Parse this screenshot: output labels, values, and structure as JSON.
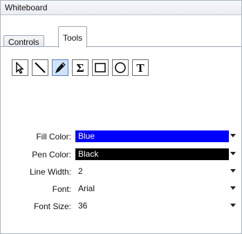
{
  "window": {
    "title": "Whiteboard"
  },
  "tabs": [
    {
      "label": "Controls",
      "active": false
    },
    {
      "label": "Tools",
      "active": true
    }
  ],
  "tools": [
    {
      "name": "select-pointer-icon",
      "selected": false
    },
    {
      "name": "line-icon",
      "selected": false
    },
    {
      "name": "pen-icon",
      "selected": true
    },
    {
      "name": "sigma-icon",
      "selected": false
    },
    {
      "name": "rectangle-icon",
      "selected": false
    },
    {
      "name": "ellipse-icon",
      "selected": false
    },
    {
      "name": "text-icon",
      "selected": false
    }
  ],
  "properties": {
    "fill_color": {
      "label": "Fill Color:",
      "value": "Blue",
      "swatch": "#0000ff",
      "text_color": "#ffffff"
    },
    "pen_color": {
      "label": "Pen Color:",
      "value": "Black",
      "swatch": "#000000",
      "text_color": "#ffffff"
    },
    "line_width": {
      "label": "Line Width:",
      "value": "2"
    },
    "font": {
      "label": "Font:",
      "value": "Arial"
    },
    "font_size": {
      "label": "Font Size:",
      "value": "36"
    }
  },
  "colors": {
    "selection": "#cfe3fb",
    "border": "#9aa6b5"
  }
}
